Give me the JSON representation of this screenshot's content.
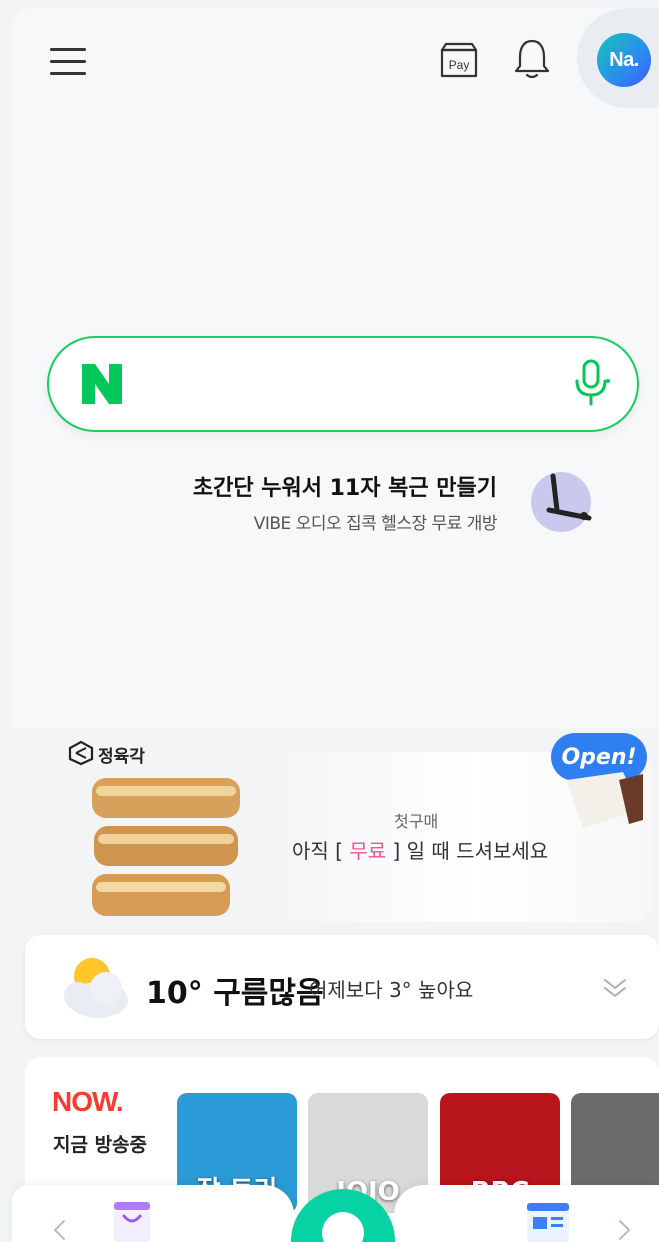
{
  "header": {
    "pay_label": "Pay",
    "avatar_label": "Na.",
    "icons": [
      "menu-icon",
      "pay-icon",
      "bell-icon"
    ]
  },
  "search": {
    "logo_letter": "N",
    "placeholder": "",
    "icons": [
      "naver-n-logo",
      "mic-icon"
    ]
  },
  "promo": {
    "title": "초간단 누워서 11자 복근 만들기",
    "subtitle": "VIBE 오디오 집콕 헬스장 무료 개방"
  },
  "ad": {
    "brand": "정육각",
    "kicker": "첫구매",
    "text_before": "아직 [ ",
    "text_highlight": "무료",
    "text_after": " ] 일 때 드셔보세요",
    "badge": "Open!"
  },
  "weather": {
    "temp_condition": "10° 구름많음",
    "compare": "어제보다 3° 높아요",
    "icon": "cloud-sun-icon"
  },
  "now": {
    "logo": "NOW.",
    "live_label": "지금 방송중",
    "thumbs": [
      {
        "caption": "잡 토리",
        "bg": "#2a9bd6"
      },
      {
        "caption": "JOJO",
        "bg": "#d9d9d9"
      },
      {
        "caption": "BBC",
        "bg": "#b8141b"
      },
      {
        "caption": "",
        "bg": "#6b6b6b"
      }
    ]
  },
  "bottom_nav": {
    "icons": [
      "arrow-left-icon",
      "shopping-icon",
      "green-dot-button",
      "news-icon",
      "arrow-right-icon"
    ]
  },
  "colors": {
    "naver_green": "#19ce60",
    "accent_blue": "#2f7ff0",
    "now_red": "#f73b2e",
    "highlight_pink": "#f0568a"
  }
}
